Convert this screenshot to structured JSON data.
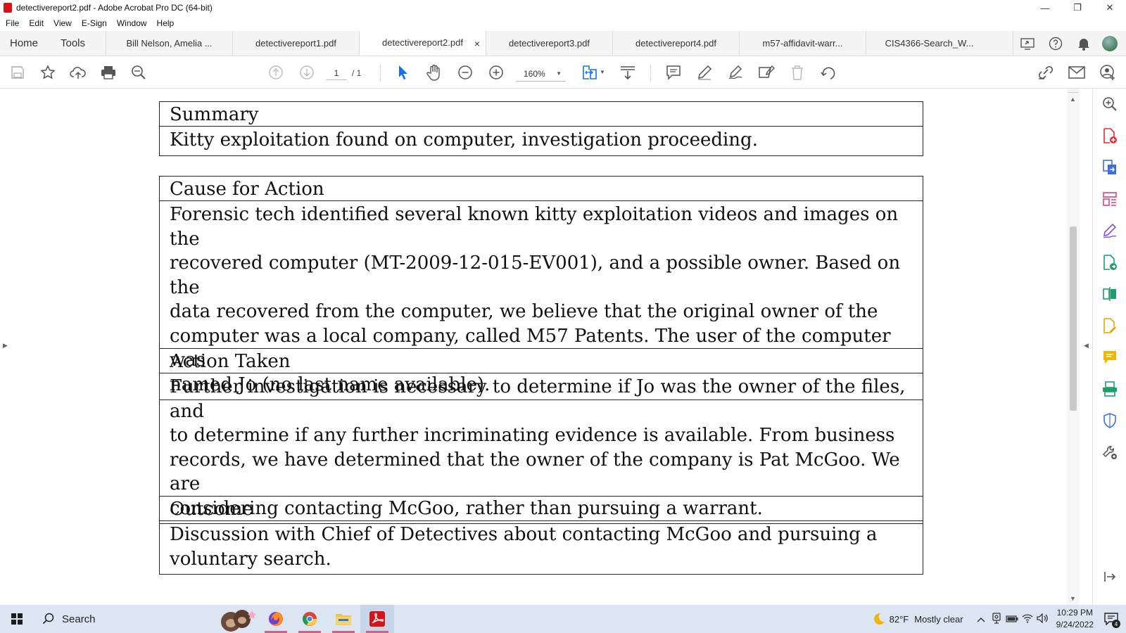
{
  "window": {
    "title": "detectivereport2.pdf - Adobe Acrobat Pro DC (64-bit)",
    "controls": {
      "minimize": "—",
      "restore": "❐",
      "close": "✕"
    }
  },
  "menu": [
    "File",
    "Edit",
    "View",
    "E-Sign",
    "Window",
    "Help"
  ],
  "tabs": {
    "home": "Home",
    "tools": "Tools",
    "documents": [
      {
        "label": "Bill Nelson, Amelia ...",
        "active": false
      },
      {
        "label": "detectivereport1.pdf",
        "active": false
      },
      {
        "label": "detectivereport2.pdf",
        "active": true,
        "close": "×"
      },
      {
        "label": "detectivereport3.pdf",
        "active": false
      },
      {
        "label": "detectivereport4.pdf",
        "active": false
      },
      {
        "label": "m57-affidavit-warr...",
        "active": false
      },
      {
        "label": "CIS4366-Search_W...",
        "active": false
      }
    ]
  },
  "toolbar": {
    "page_current": "1",
    "page_total": "/  1",
    "zoom": "160%"
  },
  "document": {
    "sections": [
      {
        "heading": "Summary",
        "body": [
          "Kitty exploitation found on computer, investigation proceeding."
        ]
      },
      {
        "heading": "Cause for Action",
        "body": [
          "Forensic tech identified several known kitty exploitation videos and images on the",
          "recovered computer (MT-2009-12-015-EV001), and a possible owner. Based on the",
          "data recovered from the computer, we believe that the original owner of the",
          "computer was a local company, called M57 Patents. The user of the computer was",
          "named Jo (no last name available)."
        ]
      },
      {
        "heading": "Action Taken",
        "body": [
          "Further investigation is necessary to determine if Jo was the owner of the files, and",
          "to determine if any further incriminating evidence is available. From business",
          "records, we have determined that the owner of the company is Pat McGoo. We are",
          "considering contacting McGoo, rather than pursuing a warrant."
        ]
      },
      {
        "heading": "Outcome",
        "body": [
          "Discussion with Chief of Detectives about contacting McGoo and pursuing a",
          "voluntary search."
        ]
      }
    ]
  },
  "taskbar": {
    "search_label": "Search",
    "weather_temp": "82°F",
    "weather_desc": "Mostly clear",
    "time": "10:29 PM",
    "date": "9/24/2022",
    "notifications": "4"
  },
  "colors": {
    "accent": "#1473e6",
    "acrobat_red": "#d7131a",
    "taskbar": "#dce6f2"
  }
}
